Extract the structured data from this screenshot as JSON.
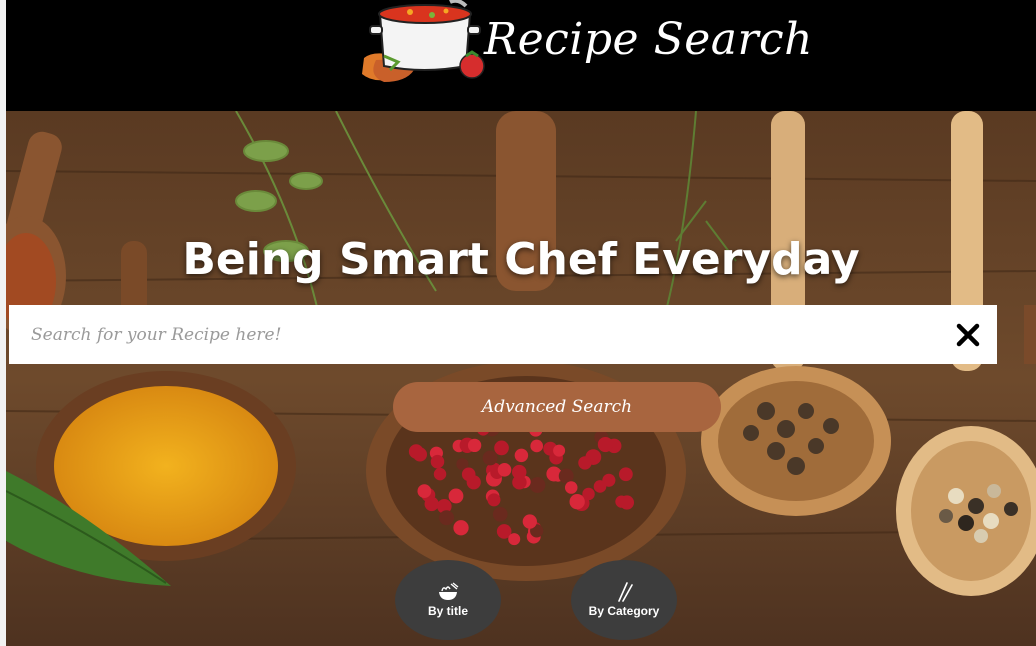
{
  "header": {
    "logo_text": "Recipe Search",
    "logo_icon": "soup-pot-icon"
  },
  "hero": {
    "tagline": "Being Smart Chef Everyday"
  },
  "search": {
    "placeholder": "Search for your Recipe here!",
    "value": "",
    "clear_icon": "close-icon"
  },
  "advanced_search": {
    "label": "Advanced Search"
  },
  "browse": [
    {
      "label": "By title",
      "icon": "noodle-bowl-icon"
    },
    {
      "label": "By Category",
      "icon": "chopsticks-icon"
    }
  ],
  "colors": {
    "header_bg": "#000000",
    "accent_brown": "#a8653f",
    "circle_bg": "#3d3d3d"
  }
}
